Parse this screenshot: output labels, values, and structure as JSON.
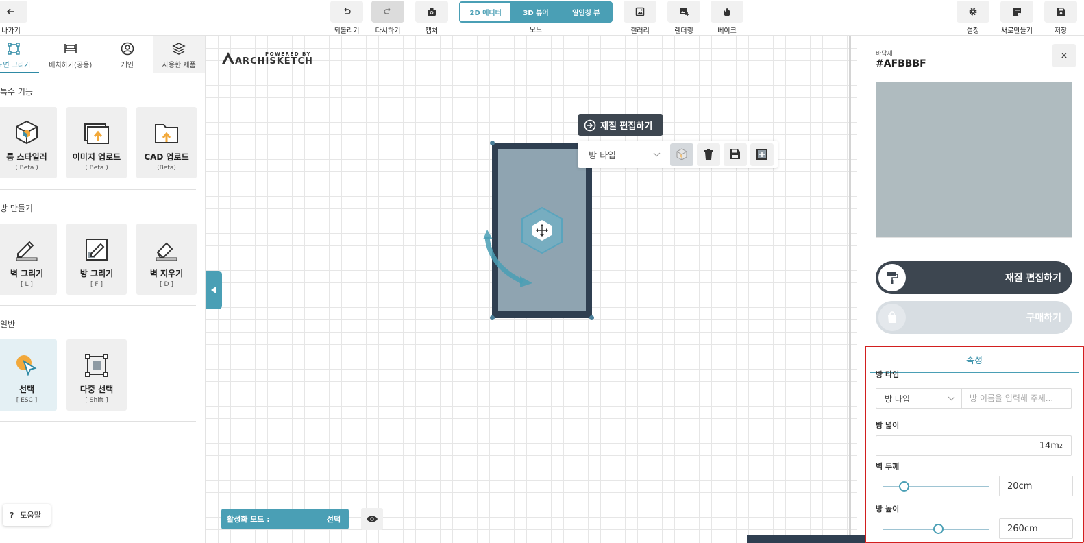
{
  "toolbar": {
    "back_label": "나가기",
    "undo_label": "되돌리기",
    "redo_label": "다시하기",
    "capture_label": "캡처",
    "mode_label": "모드",
    "modes": [
      "2D 에디터",
      "3D 뷰어",
      "일인칭 뷰"
    ],
    "active_mode": "2D 에디터",
    "gallery_label": "갤러리",
    "render_label": "렌더링",
    "bake_label": "베이크",
    "settings_label": "설정",
    "new_label": "새로만들기",
    "save_label": "저장"
  },
  "left_panel": {
    "tabs": [
      "도면 그리기",
      "배치하기(공용)",
      "개인",
      "사용한 제품"
    ],
    "selected_tab": "도면 그리기",
    "sections": [
      {
        "title": "특수 기능",
        "cards": [
          {
            "name": "룸 스타일러",
            "sub": "( Beta )",
            "icon": "cube-icon"
          },
          {
            "name": "이미지 업로드",
            "sub": "( Beta )",
            "icon": "image-upload-icon"
          },
          {
            "name": "CAD 업로드",
            "sub": "(Beta)",
            "icon": "folder-upload-icon"
          }
        ]
      },
      {
        "title": "방 만들기",
        "cards": [
          {
            "name": "벽 그리기",
            "sub": "[ L ]",
            "icon": "wall-pencil-icon"
          },
          {
            "name": "방 그리기",
            "sub": "[ F ]",
            "icon": "room-pencil-icon"
          },
          {
            "name": "벽 지우기",
            "sub": "[ D ]",
            "icon": "eraser-icon"
          }
        ]
      },
      {
        "title": "일반",
        "cards": [
          {
            "name": "선택",
            "sub": "[ ESC ]",
            "icon": "cursor-icon"
          },
          {
            "name": "다중 선택",
            "sub": "[ Shift ]",
            "icon": "multi-select-icon"
          }
        ]
      }
    ],
    "help_label": "도움말"
  },
  "canvas": {
    "logo_powered": "POWERED BY",
    "logo_brand": "ARCHISKETCH",
    "edit_tooltip": "재질 편집하기",
    "context_select": "방 타입",
    "active_mode_label": "활성화 모드 :",
    "active_mode_value": "선택"
  },
  "right_panel": {
    "category": "바닥재",
    "hex_code": "#AFBBBF",
    "swatch_color": "#AFBBBF",
    "close_label": "×",
    "edit_button": "재질 편집하기",
    "buy_button": "구매하기",
    "properties": {
      "tab_label": "속성",
      "room_type_label": "방 타입",
      "room_type_value": "방 타입",
      "room_name_placeholder": "방 이름을 입력해 주세...",
      "area_label": "방 넓이",
      "area_value": "14m",
      "area_unit_sup": "2",
      "wall_thickness_label": "벽 두께",
      "wall_thickness_value": "20cm",
      "wall_thickness_slider": 0.2,
      "room_height_label": "방 높이",
      "room_height_value": "260cm",
      "room_height_slider": 0.52
    }
  },
  "colors": {
    "accent": "#4a9fb5",
    "dark": "#3d4650",
    "highlight_border": "#d21f1f"
  }
}
